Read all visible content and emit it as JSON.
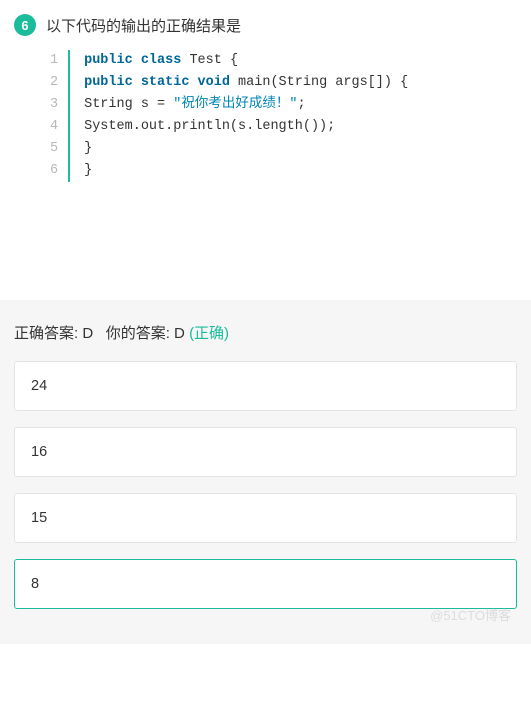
{
  "question": {
    "number": "6",
    "title": "以下代码的输出的正确结果是",
    "code": {
      "lines": [
        "1",
        "2",
        "3",
        "4",
        "5",
        "6"
      ],
      "l1_kw1": "public",
      "l1_kw2": "class",
      "l1_rest": " Test {",
      "l2_kw1": "public",
      "l2_kw2": "static",
      "l2_kw3": "void",
      "l2_rest": " main(String args[]) {",
      "l3_pre": "String s = ",
      "l3_str": "\"祝你考出好成绩！\"",
      "l3_post": ";",
      "l4": "System.out.println(s.length());",
      "l5": "}",
      "l6": "}"
    }
  },
  "answer": {
    "correct_label": "正确答案: ",
    "correct_value": "D",
    "your_label": "你的答案: ",
    "your_value": "D",
    "status": "(正确)"
  },
  "options": {
    "a": "24",
    "b": "16",
    "c": "15",
    "d": "8"
  },
  "watermark": "@51CTO博客"
}
